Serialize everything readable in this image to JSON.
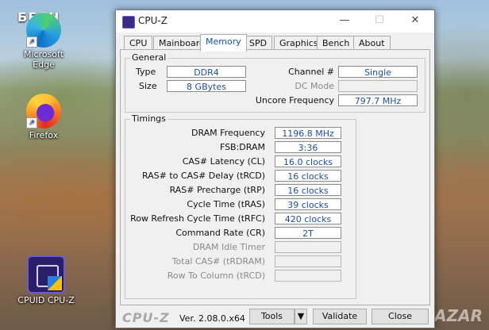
{
  "desktop": {
    "overlay_text": "БЕЛЧ",
    "watermark": "BAZAR",
    "icons": [
      {
        "label": "Microsoft Edge"
      },
      {
        "label": "Firefox"
      },
      {
        "label": "CPUID CPU-Z"
      }
    ]
  },
  "window": {
    "title": "CPU-Z",
    "tabs": [
      "CPU",
      "Mainboard",
      "Memory",
      "SPD",
      "Graphics",
      "Bench",
      "About"
    ],
    "active_tab": "Memory",
    "general": {
      "legend": "General",
      "type_label": "Type",
      "type_value": "DDR4",
      "size_label": "Size",
      "size_value": "8 GBytes",
      "channel_label": "Channel #",
      "channel_value": "Single",
      "dcmode_label": "DC Mode",
      "dcmode_value": "",
      "uncore_label": "Uncore Frequency",
      "uncore_value": "797.7 MHz"
    },
    "timings": {
      "legend": "Timings",
      "rows": [
        {
          "label": "DRAM Frequency",
          "value": "1196.8 MHz",
          "enabled": true
        },
        {
          "label": "FSB:DRAM",
          "value": "3:36",
          "enabled": true
        },
        {
          "label": "CAS# Latency (CL)",
          "value": "16.0 clocks",
          "enabled": true
        },
        {
          "label": "RAS# to CAS# Delay (tRCD)",
          "value": "16 clocks",
          "enabled": true
        },
        {
          "label": "RAS# Precharge (tRP)",
          "value": "16 clocks",
          "enabled": true
        },
        {
          "label": "Cycle Time (tRAS)",
          "value": "39 clocks",
          "enabled": true
        },
        {
          "label": "Row Refresh Cycle Time (tRFC)",
          "value": "420 clocks",
          "enabled": true
        },
        {
          "label": "Command Rate (CR)",
          "value": "2T",
          "enabled": true
        },
        {
          "label": "DRAM Idle Timer",
          "value": "",
          "enabled": false
        },
        {
          "label": "Total CAS# (tRDRAM)",
          "value": "",
          "enabled": false
        },
        {
          "label": "Row To Column (tRCD)",
          "value": "",
          "enabled": false
        }
      ]
    },
    "footer": {
      "logo": "CPU-Z",
      "version": "Ver. 2.08.0.x64",
      "tools_label": "Tools",
      "validate_label": "Validate",
      "close_label": "Close"
    }
  }
}
